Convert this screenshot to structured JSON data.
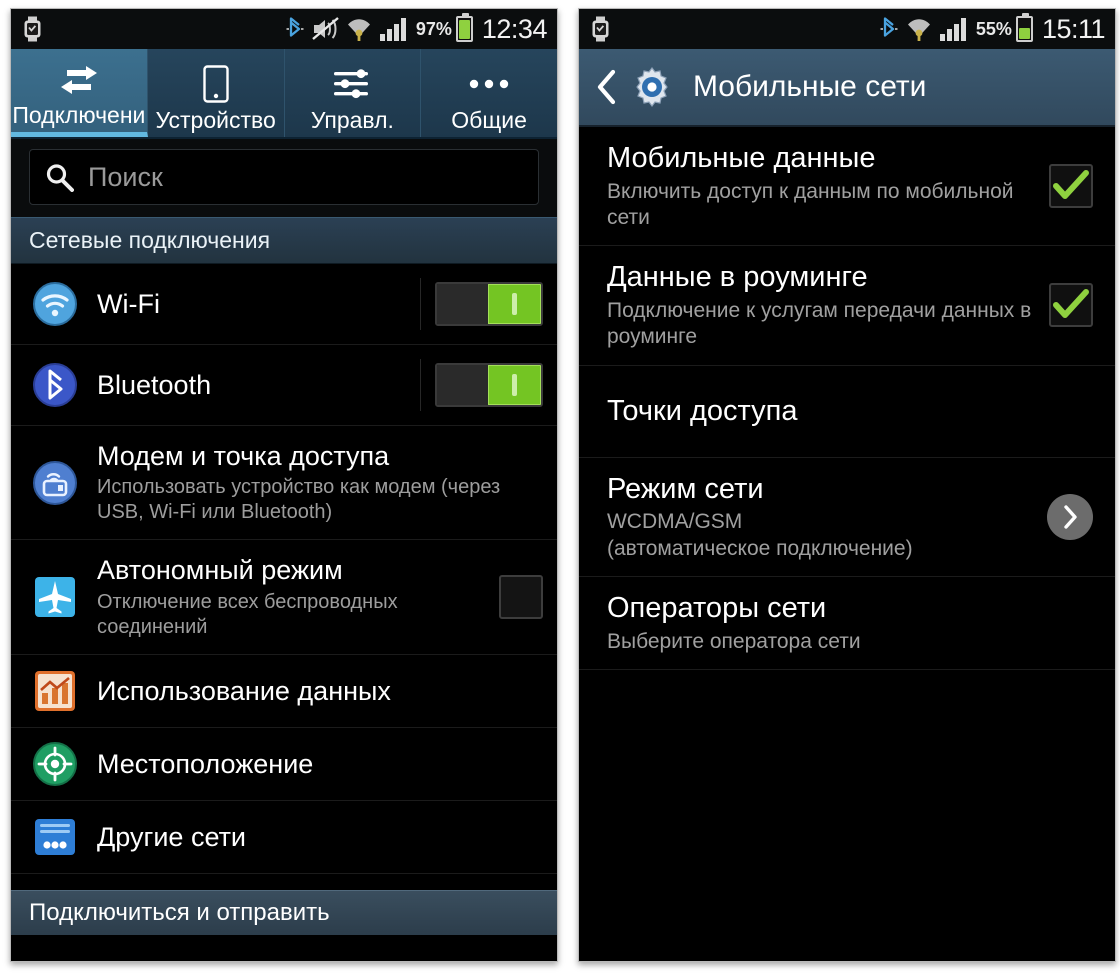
{
  "left_phone": {
    "status_bar": {
      "watch_icon": "smartwatch-icon",
      "bluetooth_icon": "bluetooth-icon",
      "mute_icon": "sound-muted-icon",
      "wifi_icon": "wifi-icon",
      "signal_icon": "cellular-signal-icon",
      "battery_percent": "97%",
      "battery_level": 97,
      "clock": "12:34"
    },
    "tabs": [
      {
        "label": "Подключени",
        "icon": "connections-arrows-icon",
        "active": true
      },
      {
        "label": "Устройство",
        "icon": "phone-device-icon",
        "active": false
      },
      {
        "label": "Управл.",
        "icon": "sliders-icon",
        "active": false
      },
      {
        "label": "Общие",
        "icon": "more-dots-icon",
        "active": false
      }
    ],
    "search": {
      "icon": "search-icon",
      "placeholder": "Поиск",
      "value": ""
    },
    "section_title": "Сетевые подключения",
    "items": [
      {
        "title": "Wi-Fi",
        "subtitle": "",
        "icon": "wifi-circle-icon",
        "control": "toggle",
        "state": "on"
      },
      {
        "title": "Bluetooth",
        "subtitle": "",
        "icon": "bluetooth-circle-icon",
        "control": "toggle",
        "state": "on"
      },
      {
        "title": "Модем и точка доступа",
        "subtitle": "Использовать устройство как модем (через USB, Wi-Fi или Bluetooth)",
        "icon": "tethering-hotspot-icon",
        "control": "none",
        "state": ""
      },
      {
        "title": "Автономный режим",
        "subtitle": "Отключение всех беспроводных соединений",
        "icon": "airplane-mode-icon",
        "control": "checkbox",
        "state": "off"
      },
      {
        "title": "Использование данных",
        "subtitle": "",
        "icon": "data-usage-chart-icon",
        "control": "none",
        "state": ""
      },
      {
        "title": "Местоположение",
        "subtitle": "",
        "icon": "location-crosshair-icon",
        "control": "none",
        "state": ""
      },
      {
        "title": "Другие сети",
        "subtitle": "",
        "icon": "more-networks-icon",
        "control": "none",
        "state": ""
      }
    ],
    "footer_label": "Подключиться и отправить"
  },
  "right_phone": {
    "status_bar": {
      "watch_icon": "smartwatch-icon",
      "bluetooth_icon": "bluetooth-icon",
      "wifi_icon": "wifi-icon",
      "signal_icon": "cellular-signal-icon",
      "battery_percent": "55%",
      "battery_level": 55,
      "clock": "15:11"
    },
    "action_bar": {
      "back_icon": "back-chevron-icon",
      "app_icon": "settings-gear-icon",
      "title": "Мобильные сети"
    },
    "items": [
      {
        "title": "Мобильные данные",
        "subtitle": "Включить доступ к данным по мобильной сети",
        "control": "checkbox",
        "state": "on"
      },
      {
        "title": "Данные в роуминге",
        "subtitle": "Подключение к услугам передачи данных в роуминге",
        "control": "checkbox",
        "state": "on"
      },
      {
        "title": "Точки доступа",
        "subtitle": "",
        "control": "none",
        "state": ""
      },
      {
        "title": "Режим сети",
        "subtitle": "WCDMA/GSM\n(автоматическое подключение)",
        "control": "chevron",
        "state": ""
      },
      {
        "title": "Операторы сети",
        "subtitle": "Выберите оператора сети",
        "control": "none",
        "state": ""
      }
    ]
  },
  "colors": {
    "accent_blue": "#3c708f",
    "tab_bar": "#26455c",
    "toggle_green": "#74c523",
    "check_green": "#8fd13f",
    "battery_green": "#8fd13f",
    "list_bg": "#000000",
    "subtitle_gray": "#9d9d9d"
  }
}
